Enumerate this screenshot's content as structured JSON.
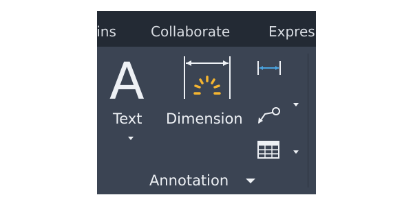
{
  "tabs": [
    {
      "label": "-ins"
    },
    {
      "label": "Collaborate"
    },
    {
      "label": "Expres"
    }
  ],
  "panel": {
    "title": "Annotation",
    "tools": {
      "text": {
        "label": "Text",
        "glyph": "A",
        "icon": "text-icon"
      },
      "dimension": {
        "label": "Dimension",
        "icon": "dimension-icon"
      },
      "linear": {
        "icon": "linear-dimension-icon"
      },
      "leader": {
        "icon": "leader-icon"
      },
      "table": {
        "icon": "table-icon"
      }
    }
  },
  "colors": {
    "ribbon_bg": "#3b4453",
    "tab_bar_bg": "#232a34",
    "text_light": "#eef1f5",
    "accent_blue": "#4aa3df",
    "accent_yellow": "#f5b531"
  }
}
